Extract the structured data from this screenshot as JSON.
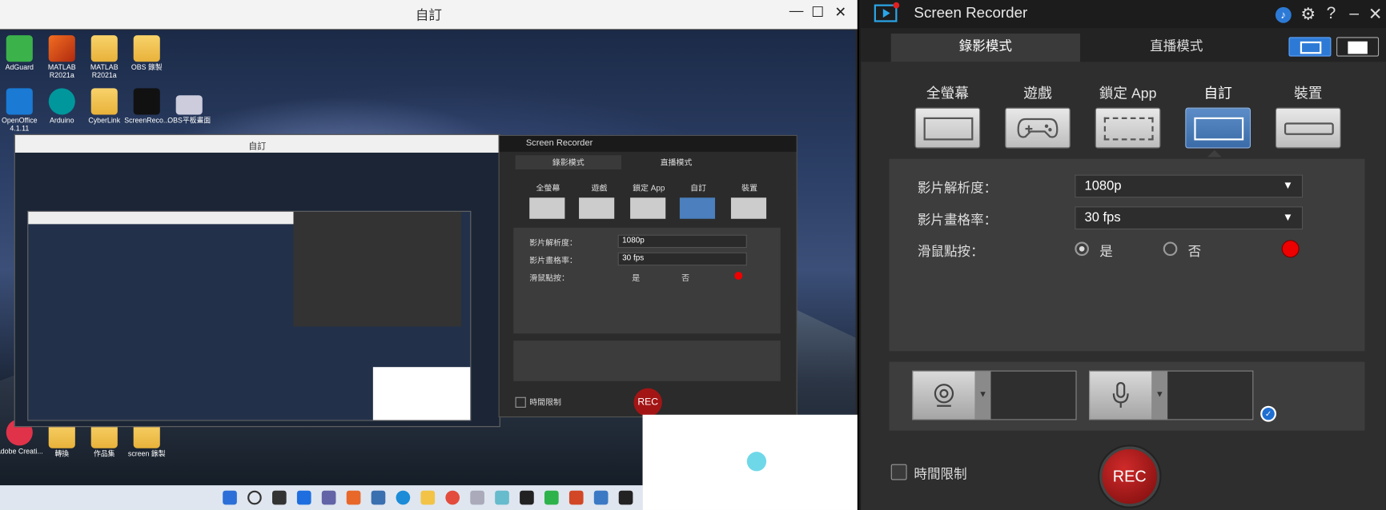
{
  "left_window": {
    "title": "自訂"
  },
  "desktop_icons": [
    {
      "label": "AdGuard"
    },
    {
      "label": "MATLAB R2021a"
    },
    {
      "label": "MATLAB R2021a"
    },
    {
      "label": "OBS 錄製"
    },
    {
      "label": "OpenOffice 4.1.11"
    },
    {
      "label": "Arduino"
    },
    {
      "label": "CyberLink"
    },
    {
      "label": "ScreenReco..."
    },
    {
      "label": "OBS平板畫面"
    },
    {
      "label": "Adobe Creati..."
    },
    {
      "label": "轉換"
    },
    {
      "label": "作品集"
    },
    {
      "label": "screen 錄製"
    }
  ],
  "nested": {
    "title": "自訂"
  },
  "mini_recorder": {
    "title": "Screen Recorder",
    "tab_record": "錄影模式",
    "tab_live": "直播模式",
    "modes": [
      "全螢幕",
      "遊戲",
      "鎖定 App",
      "自訂",
      "裝置"
    ],
    "res_label": "影片解析度：",
    "res_value": "1080p",
    "fps_label": "影片畫格率：",
    "fps_value": "30 fps",
    "click_label": "滑鼠點按：",
    "yes": "是",
    "no": "否",
    "time_limit": "時間限制",
    "rec": "REC"
  },
  "recorder": {
    "title": "Screen Recorder",
    "tabs": [
      {
        "label": "錄影模式",
        "active": true
      },
      {
        "label": "直播模式",
        "active": false
      }
    ],
    "modes": [
      {
        "label": "全螢幕",
        "icon": "fullscreen-icon"
      },
      {
        "label": "遊戲",
        "icon": "gamepad-icon"
      },
      {
        "label": "鎖定 App",
        "icon": "lock-app-icon"
      },
      {
        "label": "自訂",
        "icon": "custom-area-icon",
        "active": true
      },
      {
        "label": "裝置",
        "icon": "device-icon"
      }
    ],
    "resolution": {
      "label": "影片解析度：",
      "value": "1080p"
    },
    "framerate": {
      "label": "影片畫格率：",
      "value": "30 fps"
    },
    "mouse_click": {
      "label": "滑鼠點按：",
      "yes": "是",
      "no": "否",
      "selected": "是",
      "color": "#e00000"
    },
    "time_limit": "時間限制",
    "rec_button": "REC",
    "accent": "#2d7ad6"
  }
}
